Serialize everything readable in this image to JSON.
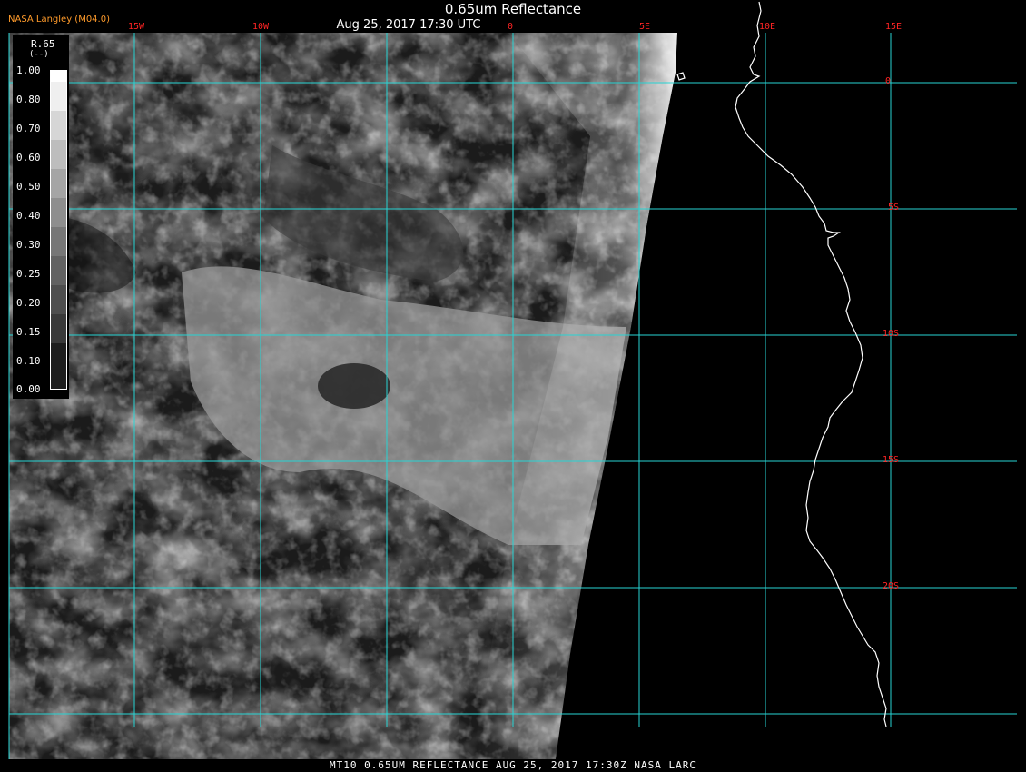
{
  "header": {
    "title": "0.65um Reflectance",
    "subtitle": "Aug 25, 2017 17:30 UTC",
    "brand": "NASA Langley (M04.0)"
  },
  "footer": {
    "caption": "MT10  0.65UM REFLECTANCE  AUG 25, 2017 17:30Z  NASA LARC"
  },
  "map": {
    "lon_labels": [
      "15W",
      "10W",
      "0",
      "5E",
      "10E",
      "15E"
    ],
    "lat_labels": [
      "0",
      "5S",
      "10S",
      "15S",
      "20S"
    ],
    "grid_color": "#27d4d4",
    "label_color": "#ff2424",
    "coastline_color": "#ffffff"
  },
  "legend": {
    "title": "R.65",
    "unit": "(--)",
    "ticks": [
      "1.00",
      "0.80",
      "0.70",
      "0.60",
      "0.50",
      "0.40",
      "0.30",
      "0.25",
      "0.20",
      "0.15",
      "0.10",
      "0.00"
    ]
  }
}
